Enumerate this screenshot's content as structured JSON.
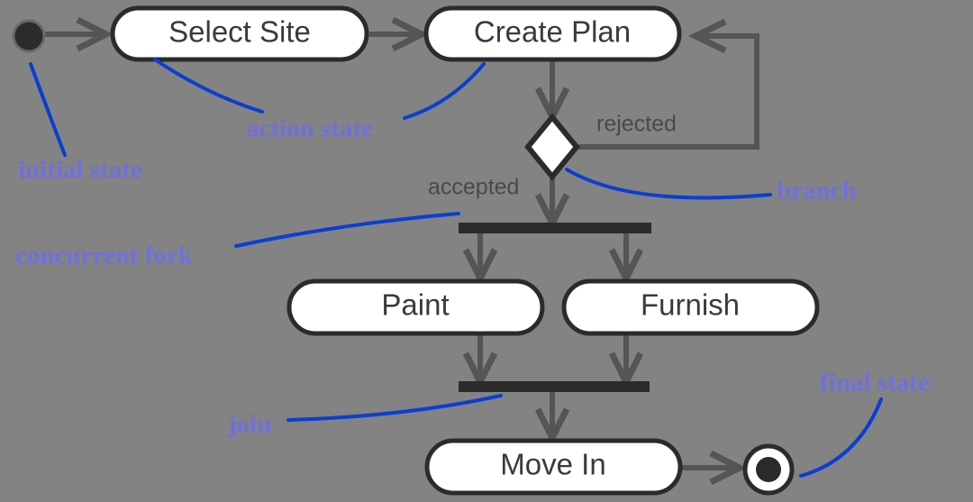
{
  "diagram": {
    "type": "uml-activity-diagram",
    "background_color": "#838383",
    "node_text_color": "#3a3a3a",
    "node_fill_color": "#ffffff",
    "node_border_color": "#2b2b2b",
    "flow_color": "#555555",
    "bar_color": "#2b2b2b",
    "annotation_text_color": "#6f6fdf",
    "annotation_leader_color": "#0a3fd0",
    "guard_text_color": "#4a4a4a"
  },
  "states": {
    "initial": {
      "name": "initial-state",
      "shape": "filled-circle"
    },
    "select_site": {
      "label": "Select Site"
    },
    "create_plan": {
      "label": "Create Plan"
    },
    "paint": {
      "label": "Paint"
    },
    "furnish": {
      "label": "Furnish"
    },
    "move_in": {
      "label": "Move In"
    },
    "final": {
      "name": "final-state",
      "shape": "bullseye"
    },
    "branch": {
      "name": "decision-diamond",
      "shape": "diamond"
    },
    "fork": {
      "name": "fork-bar",
      "shape": "horizontal-bar"
    },
    "join": {
      "name": "join-bar",
      "shape": "horizontal-bar"
    }
  },
  "guards": {
    "accepted": "accepted",
    "rejected": "rejected"
  },
  "annotations": [
    {
      "id": "initial-state",
      "label": "initial state"
    },
    {
      "id": "action-state",
      "label": "action state"
    },
    {
      "id": "branch",
      "label": "branch"
    },
    {
      "id": "concurrent-fork",
      "label": "concurrent fork"
    },
    {
      "id": "join",
      "label": "join"
    },
    {
      "id": "final-state",
      "label": "final state"
    }
  ]
}
